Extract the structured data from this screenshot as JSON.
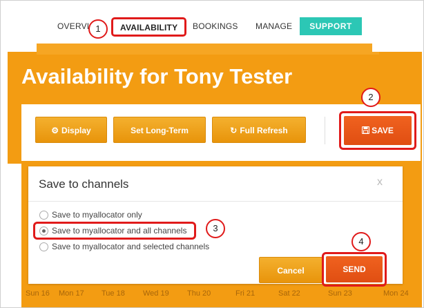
{
  "nav": {
    "items": [
      {
        "label": "OVERVI"
      },
      {
        "label": "AVAILABILITY"
      },
      {
        "label": "BOOKINGS"
      },
      {
        "label": "MANAGE"
      }
    ],
    "support_label": "SUPPORT"
  },
  "steps": [
    "1",
    "2",
    "3",
    "4"
  ],
  "hero": {
    "title": "Availability for Tony Tester"
  },
  "toolbar": {
    "display_label": "Display",
    "display_icon": "gear-icon",
    "long_term_label": "Set Long-Term",
    "full_refresh_label": "Full Refresh",
    "full_refresh_icon": "refresh-icon",
    "save_label": "SAVE",
    "save_icon": "floppy-disk-icon"
  },
  "modal": {
    "title": "Save to channels",
    "close": "x",
    "options": [
      {
        "label": "Save to myallocator only",
        "checked": false
      },
      {
        "label": "Save to myallocator and all channels",
        "checked": true
      },
      {
        "label": "Save to myallocator and selected channels",
        "checked": false
      }
    ],
    "cancel_label": "Cancel",
    "send_label": "SEND"
  },
  "dates": [
    "Sun 16",
    "Mon 17",
    "Tue 18",
    "Wed 19",
    "Thu 20",
    "Fri 21",
    "Sat 22",
    "Sun 23",
    "Mon 24"
  ],
  "colors": {
    "brand_orange": "#f39c12",
    "save_orange": "#e8531a",
    "support_teal": "#2cc7b5",
    "highlight_red": "#e01a1a"
  }
}
